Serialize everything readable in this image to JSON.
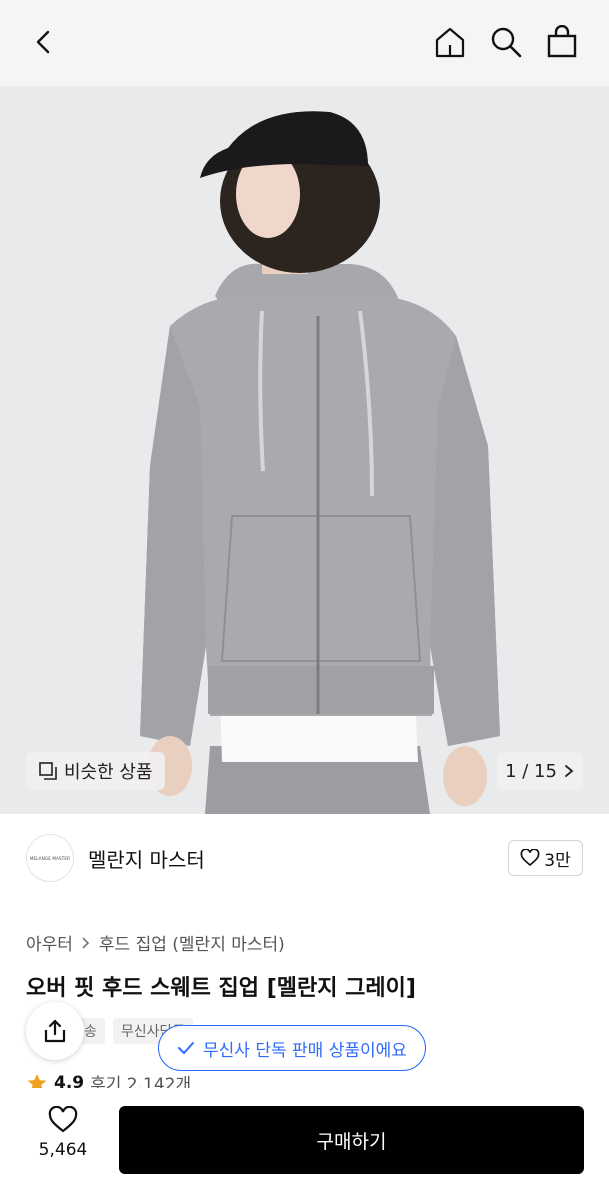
{
  "header": {
    "back_icon": "chevron-left-icon",
    "home_icon": "home-icon",
    "search_icon": "search-icon",
    "bag_icon": "shopping-bag-icon"
  },
  "gallery": {
    "similar_label": "비슷한 상품",
    "counter": "1 / 15"
  },
  "brand": {
    "logo_text": "MELANGE MASTER",
    "name": "멜란지 마스터",
    "likes": "3만"
  },
  "breadcrumb": {
    "items": [
      "아우터",
      "후드 집업 (멜란지 마스터)"
    ]
  },
  "product": {
    "title": "오버 핏 후드 스웨트 집업 [멜란지 그레이]",
    "tags": [
      "송",
      "무신사단독"
    ],
    "exclusive_label": "무신사 단독 판매 상품이에요",
    "rating": "4.9",
    "reviews": "후기 2,142개"
  },
  "bottom": {
    "wish_count": "5,464",
    "buy_label": "구매하기"
  },
  "colors": {
    "accent": "#2f6bff",
    "star": "#f0a020",
    "buy_button": "#000000"
  }
}
